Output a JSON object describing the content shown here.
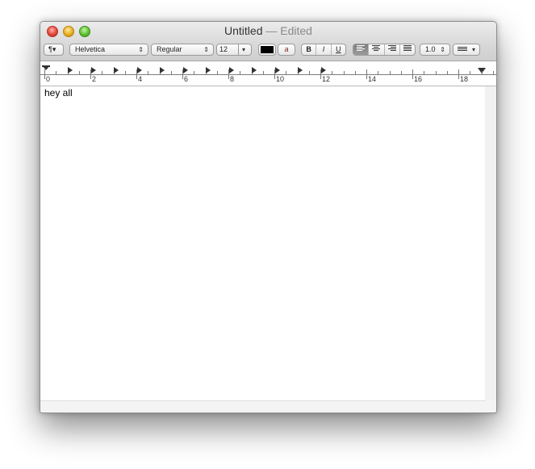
{
  "window": {
    "title": "Untitled",
    "title_status": "— Edited"
  },
  "toolbar": {
    "paragraph_menu": "¶▾",
    "font_family": "Helvetica",
    "font_style": "Regular",
    "font_size": "12",
    "text_color": "#000000",
    "bold_label": "B",
    "italic_label": "I",
    "underline_label": "U",
    "alignment_selected": "left",
    "line_spacing": "1.0",
    "highlight_label": "a"
  },
  "ruler": {
    "numbers": [
      "0",
      "2",
      "4",
      "6",
      "8",
      "10",
      "12",
      "14",
      "16",
      "18"
    ]
  },
  "document": {
    "text": "hey all"
  }
}
